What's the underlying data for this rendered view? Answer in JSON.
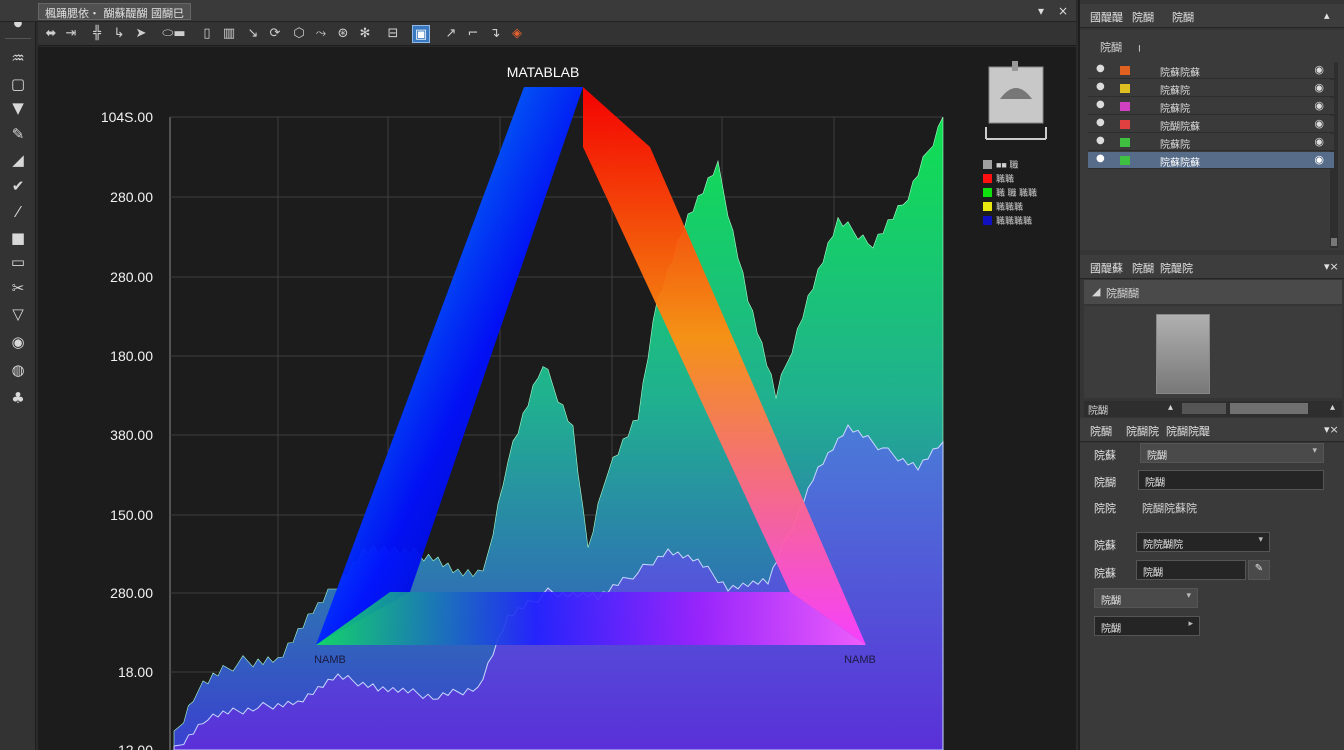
{
  "menubar": {
    "menu_label": "楓踊腮依・ 醐蘇醍醐 國醐巳",
    "minimize": "▾",
    "close": "×"
  },
  "toolbar": {
    "icons": [
      "move-icon",
      "select-icon",
      "grid-icon",
      "pen-icon",
      "pointer-icon",
      "slider-icon",
      "frame-icon",
      "table-icon",
      "arrow-icon",
      "rotate-icon",
      "shape-icon",
      "link-icon",
      "target-icon",
      "gear-icon",
      "layers-icon",
      "hand-icon",
      "cursor-icon",
      "pencil-icon",
      "record-icon"
    ]
  },
  "leftbar": {
    "tools": [
      "dot-icon",
      "brush-icon",
      "frame-icon",
      "eraser-icon",
      "pen-icon",
      "knife-icon",
      "spanner-icon",
      "curve-icon",
      "square-icon",
      "screen-icon",
      "scissors-icon",
      "triangle-icon",
      "circle-fill-icon",
      "globe-icon",
      "hat-icon"
    ]
  },
  "plot": {
    "title": "MATABLAB",
    "yticks": [
      "104S.00",
      "280.00",
      "280.00",
      "180.00",
      "380.00",
      "150.00",
      "280.00",
      "18.00",
      "12.00"
    ],
    "triangle_label": "NAMB",
    "legend": [
      {
        "label": "■■ 職",
        "color": "#a0a0a0"
      },
      {
        "label": "職職",
        "color": "#ff1010"
      },
      {
        "label": "職 職 職職",
        "color": "#10e010"
      },
      {
        "label": "職職職",
        "color": "#e8e810"
      },
      {
        "label": "職職職職",
        "color": "#1010c0"
      }
    ]
  },
  "layers_panel": {
    "tabs": [
      "國醍醍",
      "院醐",
      "院醐"
    ],
    "subtitle": "院醐",
    "rows": [
      {
        "name": "院蘇院蘇",
        "swatch": "#e06020",
        "selected": false
      },
      {
        "name": "院蘇院",
        "swatch": "#e0c020",
        "selected": false
      },
      {
        "name": "院蘇院",
        "swatch": "#d040c0",
        "selected": false
      },
      {
        "name": "院醐院蘇",
        "swatch": "#e04040",
        "selected": false
      },
      {
        "name": "院蘇院",
        "swatch": "#40c040",
        "selected": false
      },
      {
        "name": "院蘇院蘇",
        "swatch": "#40c040",
        "selected": true
      }
    ]
  },
  "preview_panel": {
    "tabs": [
      "國醍蘇",
      "院醐",
      "院醍院"
    ],
    "item": "院醐醐",
    "footer": "院醐"
  },
  "props_panel": {
    "tabs": [
      "院醐",
      "院醐院",
      "院醐院醍"
    ],
    "fields": [
      {
        "label": "院蘇",
        "value": "院醐"
      },
      {
        "label": "院醐",
        "value": "院醐"
      },
      {
        "label": "院院",
        "value": "院醐院蘇院"
      },
      {
        "label": "院蘇",
        "value": "院院醐院"
      },
      {
        "label": "院蘇",
        "value": "院醐"
      }
    ],
    "drop1": "院醐",
    "drop2": "院醐"
  },
  "colors": {
    "background": "#1c1c1c",
    "panel": "#353535",
    "accent": "#566c88"
  }
}
